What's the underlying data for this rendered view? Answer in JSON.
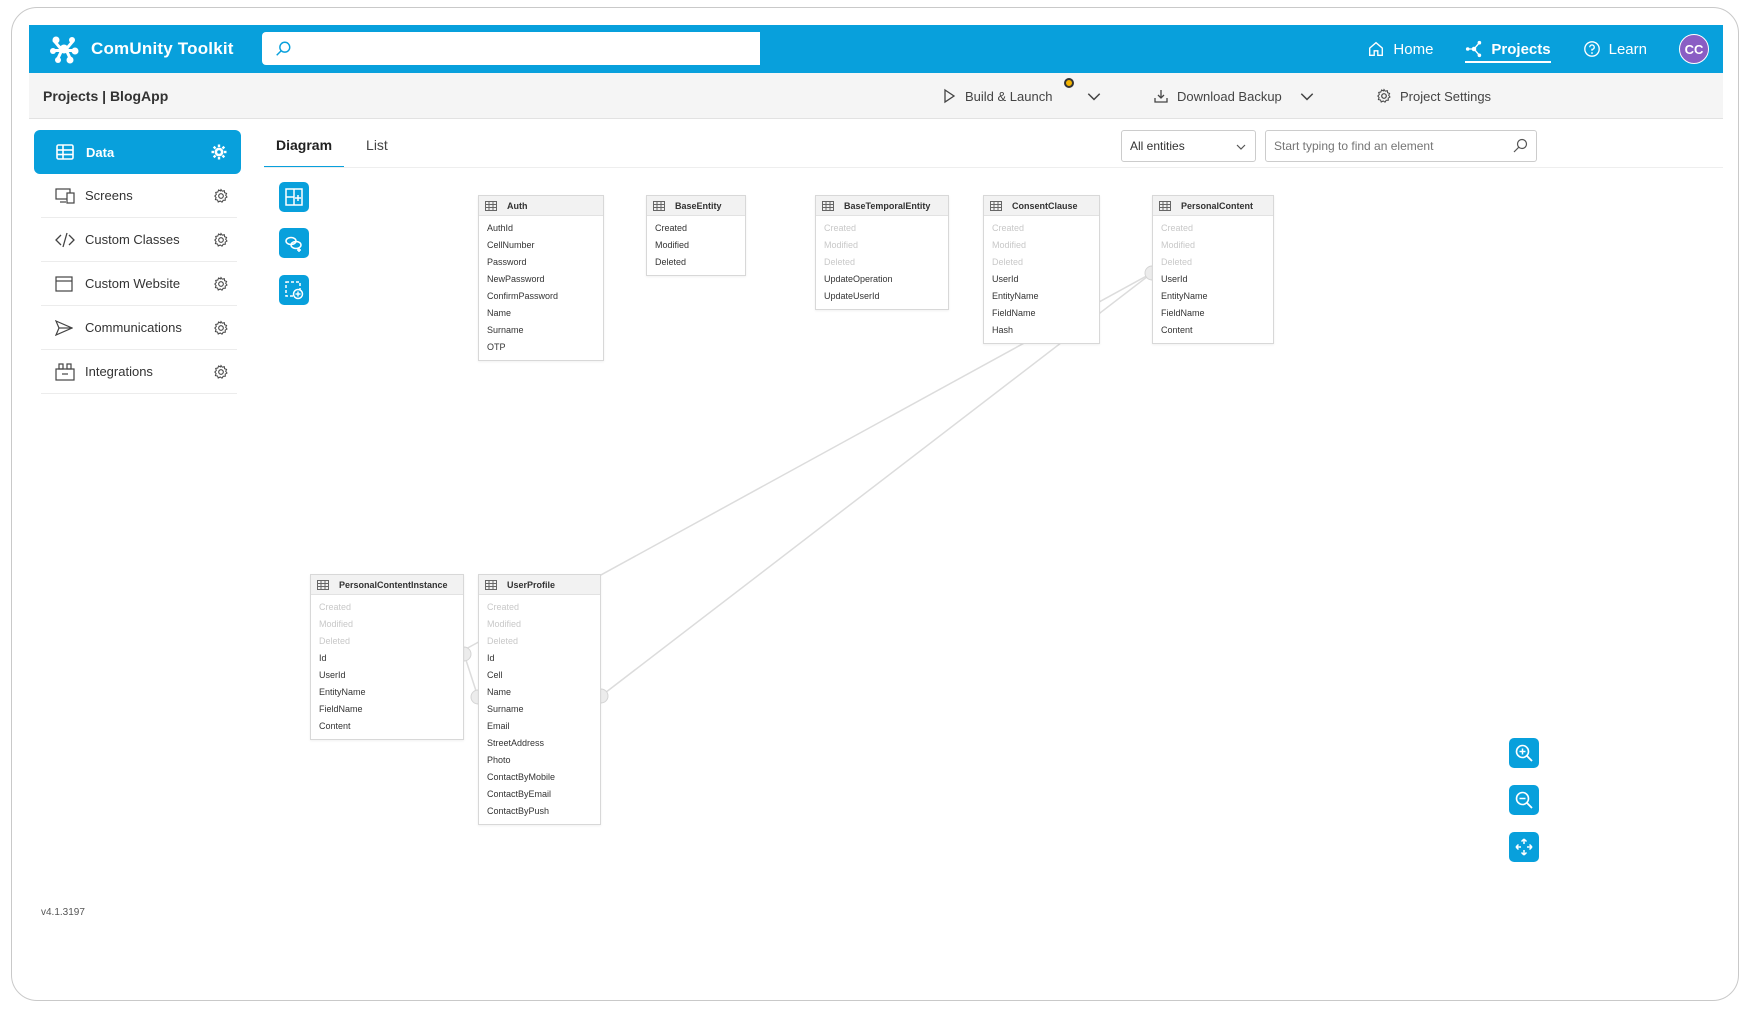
{
  "app": {
    "name": "ComUnity Toolkit",
    "version": "v4.1.3197"
  },
  "search": {
    "placeholder": ""
  },
  "nav": [
    {
      "label": "Home",
      "icon": "home-icon"
    },
    {
      "label": "Projects",
      "icon": "projects-icon",
      "active": true
    },
    {
      "label": "Learn",
      "icon": "help-icon"
    }
  ],
  "user": {
    "initials": "CC"
  },
  "breadcrumb": "Projects | BlogApp",
  "actions": {
    "build": "Build & Launch",
    "backup": "Download Backup",
    "settings": "Project Settings"
  },
  "sidebar": [
    {
      "label": "Data",
      "icon": "table-icon",
      "active": true
    },
    {
      "label": "Screens",
      "icon": "screens-icon"
    },
    {
      "label": "Custom Classes",
      "icon": "code-icon"
    },
    {
      "label": "Custom Website",
      "icon": "browser-icon"
    },
    {
      "label": "Communications",
      "icon": "send-icon"
    },
    {
      "label": "Integrations",
      "icon": "integrations-icon"
    }
  ],
  "tabs": [
    "Diagram",
    "List"
  ],
  "filter": {
    "selected": "All entities"
  },
  "find": {
    "placeholder": "Start typing to find an element"
  },
  "entities": [
    {
      "name": "Auth",
      "fields": [
        {
          "n": "AuthId"
        },
        {
          "n": "CellNumber"
        },
        {
          "n": "Password"
        },
        {
          "n": "NewPassword"
        },
        {
          "n": "ConfirmPassword"
        },
        {
          "n": "Name"
        },
        {
          "n": "Surname"
        },
        {
          "n": "OTP"
        }
      ]
    },
    {
      "name": "BaseEntity",
      "fields": [
        {
          "n": "Created"
        },
        {
          "n": "Modified"
        },
        {
          "n": "Deleted"
        }
      ]
    },
    {
      "name": "BaseTemporalEntity",
      "fields": [
        {
          "n": "Created",
          "faded": true
        },
        {
          "n": "Modified",
          "faded": true
        },
        {
          "n": "Deleted",
          "faded": true
        },
        {
          "n": "UpdateOperation"
        },
        {
          "n": "UpdateUserId"
        }
      ]
    },
    {
      "name": "ConsentClause",
      "fields": [
        {
          "n": "Created",
          "faded": true
        },
        {
          "n": "Modified",
          "faded": true
        },
        {
          "n": "Deleted",
          "faded": true
        },
        {
          "n": "UserId"
        },
        {
          "n": "EntityName"
        },
        {
          "n": "FieldName"
        },
        {
          "n": "Hash"
        }
      ]
    },
    {
      "name": "PersonalContent",
      "fields": [
        {
          "n": "Created",
          "faded": true
        },
        {
          "n": "Modified",
          "faded": true
        },
        {
          "n": "Deleted",
          "faded": true
        },
        {
          "n": "UserId"
        },
        {
          "n": "EntityName"
        },
        {
          "n": "FieldName"
        },
        {
          "n": "Content"
        }
      ]
    },
    {
      "name": "PersonalContentInstance",
      "fields": [
        {
          "n": "Created",
          "faded": true
        },
        {
          "n": "Modified",
          "faded": true
        },
        {
          "n": "Deleted",
          "faded": true
        },
        {
          "n": "Id"
        },
        {
          "n": "UserId"
        },
        {
          "n": "EntityName"
        },
        {
          "n": "FieldName"
        },
        {
          "n": "Content"
        }
      ]
    },
    {
      "name": "UserProfile",
      "fields": [
        {
          "n": "Created",
          "faded": true
        },
        {
          "n": "Modified",
          "faded": true
        },
        {
          "n": "Deleted",
          "faded": true
        },
        {
          "n": "Id"
        },
        {
          "n": "Cell"
        },
        {
          "n": "Name"
        },
        {
          "n": "Surname"
        },
        {
          "n": "Email"
        },
        {
          "n": "StreetAddress"
        },
        {
          "n": "Photo"
        },
        {
          "n": "ContactByMobile"
        },
        {
          "n": "ContactByEmail"
        },
        {
          "n": "ContactByPush"
        }
      ]
    }
  ],
  "colors": {
    "brand": "#08a0dc",
    "avatar": "#8a5dc4",
    "status": "#f5b400"
  }
}
